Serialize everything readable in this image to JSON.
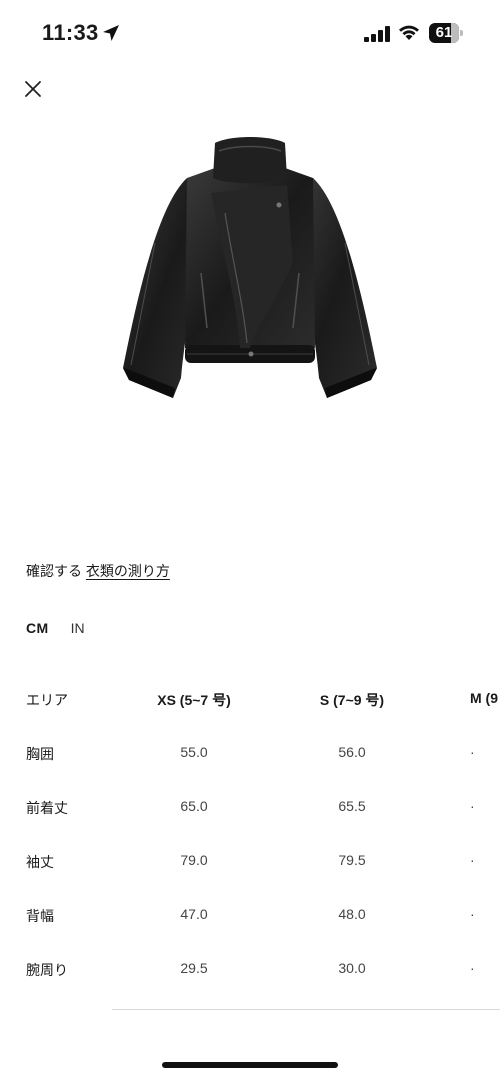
{
  "status_bar": {
    "time": "11:33",
    "battery_level": "61"
  },
  "measure": {
    "prefix": "確認する",
    "link": "衣類の測り方"
  },
  "units": {
    "cm": "CM",
    "in": "IN",
    "selected": "CM"
  },
  "size_table": {
    "header": [
      "エリア",
      "XS (5~7 号)",
      "S (7~9 号)",
      "M (9"
    ],
    "rows": [
      [
        "胸囲",
        "55.0",
        "56.0",
        "·"
      ],
      [
        "前着丈",
        "65.0",
        "65.5",
        "·"
      ],
      [
        "袖丈",
        "79.0",
        "79.5",
        "·"
      ],
      [
        "背幅",
        "47.0",
        "48.0",
        "·"
      ],
      [
        "腕周り",
        "29.5",
        "30.0",
        "·"
      ]
    ]
  },
  "icons": {
    "close": "close-icon",
    "location": "location-arrow-icon",
    "signal": "cellular-signal-icon",
    "wifi": "wifi-icon",
    "battery": "battery-icon"
  }
}
